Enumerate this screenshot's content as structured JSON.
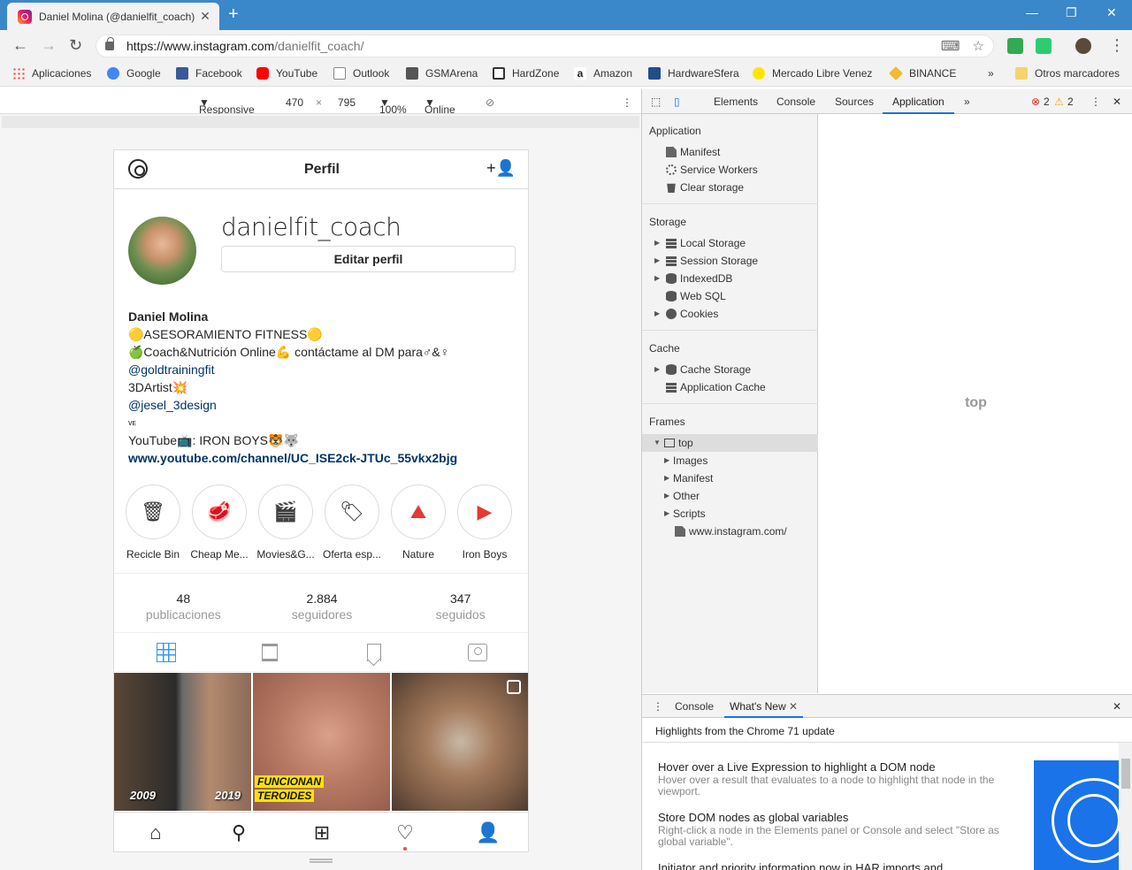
{
  "browser": {
    "tab_title": "Daniel Molina (@danielfit_coach)",
    "url_host": "https://www.instagram.com",
    "url_path": "/danielfit_coach/",
    "bookmarks": [
      {
        "label": "Aplicaciones",
        "color": "#e94235"
      },
      {
        "label": "Google",
        "color": "#4285f4"
      },
      {
        "label": "Facebook",
        "color": "#3b5998"
      },
      {
        "label": "YouTube",
        "color": "#ff0000"
      },
      {
        "label": "Outlook",
        "color": "#888888"
      },
      {
        "label": "GSMArena",
        "color": "#555555"
      },
      {
        "label": "HardZone",
        "color": "#333333"
      },
      {
        "label": "Amazon",
        "color": "#222222"
      },
      {
        "label": "HardwareSfera",
        "color": "#1f4e8c"
      },
      {
        "label": "Mercado Libre Venez",
        "color": "#ffe600"
      },
      {
        "label": "BINANCE",
        "color": "#f3ba2f"
      }
    ],
    "other_bookmarks": "Otros marcadores"
  },
  "device_toolbar": {
    "mode": "Responsive",
    "width": "470",
    "height": "795",
    "zoom": "100%",
    "network": "Online"
  },
  "instagram": {
    "header_title": "Perfil",
    "username": "danielfit_coach",
    "edit_label": "Editar perfil",
    "bio": {
      "name": "Daniel Molina",
      "line1": "🟡ASESORAMIENTO FITNESS🟡",
      "line2": "🍏Coach&Nutrición Online💪 contáctame al DM para♂&♀",
      "mention1": "@goldtrainingfit",
      "line3": "3DArtist💥",
      "mention2": "@jesel_3design",
      "line4": "ᴠᴇ",
      "line5": "YouTube📺: IRON BOYS🐯🐺",
      "link": "www.youtube.com/channel/UC_ISE2ck-JTUc_55vkx2bjg"
    },
    "highlights": [
      {
        "label": "Recicle Bin",
        "icon": "🗑"
      },
      {
        "label": "Cheap Me...",
        "icon": "🥩"
      },
      {
        "label": "Movies&G...",
        "icon": "🎬"
      },
      {
        "label": "Oferta esp...",
        "icon": "🏷"
      },
      {
        "label": "Nature",
        "icon": "⛰"
      },
      {
        "label": "Iron Boys",
        "icon": "▶"
      }
    ],
    "stats": [
      {
        "value": "48",
        "label": "publicaciones"
      },
      {
        "value": "2.884",
        "label": "seguidores"
      },
      {
        "value": "347",
        "label": "seguidos"
      }
    ],
    "posts": {
      "p1_year_left": "2009",
      "p1_year_right": "2019",
      "p2_caption_1": "FUNCIONAN",
      "p2_caption_2": "TEROIDES"
    }
  },
  "devtools": {
    "tabs": [
      "Elements",
      "Console",
      "Sources",
      "Application"
    ],
    "errors": "2",
    "warnings": "2",
    "sections": {
      "application": {
        "title": "Application",
        "items": [
          "Manifest",
          "Service Workers",
          "Clear storage"
        ]
      },
      "storage": {
        "title": "Storage",
        "items": [
          "Local Storage",
          "Session Storage",
          "IndexedDB",
          "Web SQL",
          "Cookies"
        ]
      },
      "cache": {
        "title": "Cache",
        "items": [
          "Cache Storage",
          "Application Cache"
        ]
      },
      "frames": {
        "title": "Frames",
        "top": "top",
        "items": [
          "Images",
          "Manifest",
          "Other",
          "Scripts"
        ],
        "file": "www.instagram.com/"
      }
    },
    "main_label": "top",
    "drawer": {
      "tabs": [
        "Console",
        "What's New"
      ],
      "heading": "Highlights from the Chrome 71 update",
      "news": [
        {
          "title": "Hover over a Live Expression to highlight a DOM node",
          "desc": "Hover over a result that evaluates to a node to highlight that node in the viewport."
        },
        {
          "title": "Store DOM nodes as global variables",
          "desc": "Right-click a node in the Elements panel or Console and select \"Store as global variable\"."
        },
        {
          "title": "Initiator and priority information now in HAR imports and",
          "desc": ""
        }
      ]
    }
  }
}
